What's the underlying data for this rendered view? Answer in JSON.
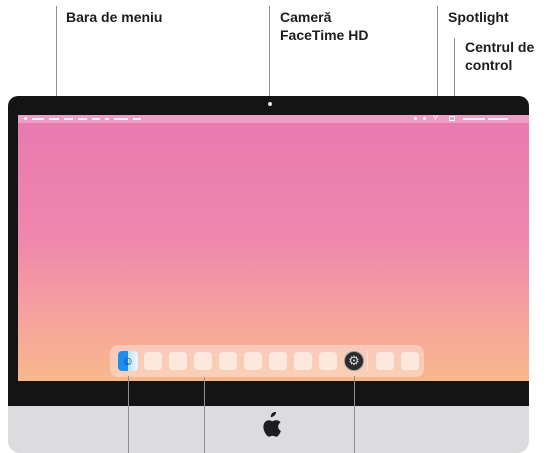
{
  "labels": {
    "menu_bar": "Bara de meniu",
    "camera_line1": "Cameră",
    "camera_line2": "FaceTime HD",
    "spotlight": "Spotlight",
    "control_center_line1": "Centrul de",
    "control_center_line2": "control"
  },
  "colors": {
    "bezel": "#141414",
    "chin": "#dcdcde",
    "wallpaper_top": "#e77ab0",
    "wallpaper_bottom": "#f8b88c"
  },
  "icons": {
    "dock_left": "finder-icon",
    "dock_right": "system-settings-icon",
    "chin_logo": "apple-logo-icon"
  },
  "dock": {
    "app_placeholders_before_settings": 8,
    "app_placeholders_after_separator": 2
  }
}
